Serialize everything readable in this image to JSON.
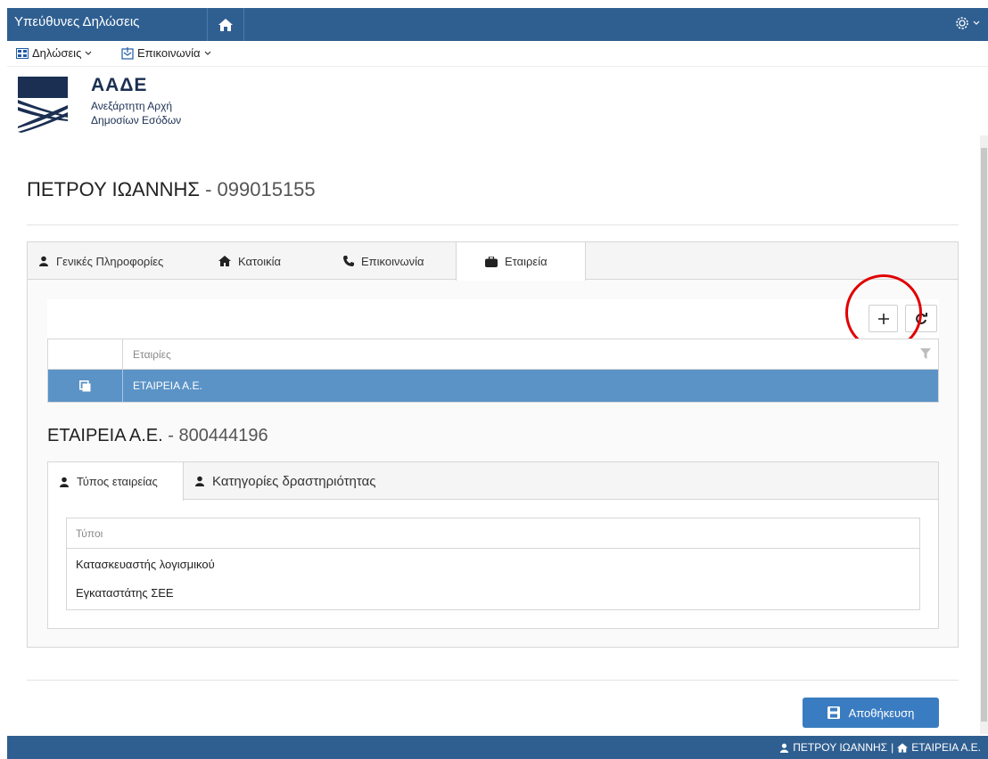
{
  "header": {
    "app_title": "Υπεύθυνες Δηλώσεις",
    "home_icon": "home-icon",
    "settings_icon": "gear-icon"
  },
  "menu": {
    "items": [
      {
        "label": "Δηλώσεις",
        "icon": "grid-icon"
      },
      {
        "label": "Επικοινωνία",
        "icon": "contact-icon"
      }
    ]
  },
  "logo": {
    "brand": "ΑΑΔΕ",
    "line1": "Ανεξάρτητη Αρχή",
    "line2": "Δημοσίων Εσόδων"
  },
  "page": {
    "person_name": "ΠΕΤΡΟΥ ΙΩΑΝΝΗΣ",
    "separator": " - ",
    "person_id": "099015155"
  },
  "outer_tabs": [
    {
      "label": "Γενικές Πληροφορίες",
      "icon": "user-icon",
      "active": false
    },
    {
      "label": "Κατοικία",
      "icon": "home-icon",
      "active": false
    },
    {
      "label": "Επικοινωνία",
      "icon": "phone-icon",
      "active": false
    },
    {
      "label": "Εταιρεία",
      "icon": "briefcase-icon",
      "active": true
    }
  ],
  "companies_grid": {
    "column_header": "Εταιρίες",
    "rows": [
      {
        "name": "ΕΤΑΙΡΕΙΑ Α.Ε.",
        "selected": true
      }
    ]
  },
  "company": {
    "name": "ΕΤΑΙΡΕΙΑ Α.Ε.",
    "separator": " - ",
    "id": "800444196"
  },
  "inner_tabs": [
    {
      "label": "Τύπος εταιρείας",
      "icon": "user-icon",
      "active": true
    },
    {
      "label": "Κατηγορίες δραστηριότητας",
      "icon": "user-icon",
      "active": false
    }
  ],
  "types_table": {
    "column_header": "Τύποι",
    "rows": [
      "Κατασκευαστής λογισμικού",
      "Εγκαταστάτης ΣΕΕ"
    ]
  },
  "actions": {
    "save_label": "Αποθήκευση"
  },
  "statusbar": {
    "user": "ΠΕΤΡΟΥ ΙΩΑΝΝΗΣ",
    "divider": "|",
    "company": "ΕΤΑΙΡΕΙΑ Α.Ε."
  },
  "colors": {
    "primary": "#2f5f91",
    "selected_row": "#5b93c6",
    "button": "#3a7cc1",
    "highlight_circle": "#e10000"
  }
}
